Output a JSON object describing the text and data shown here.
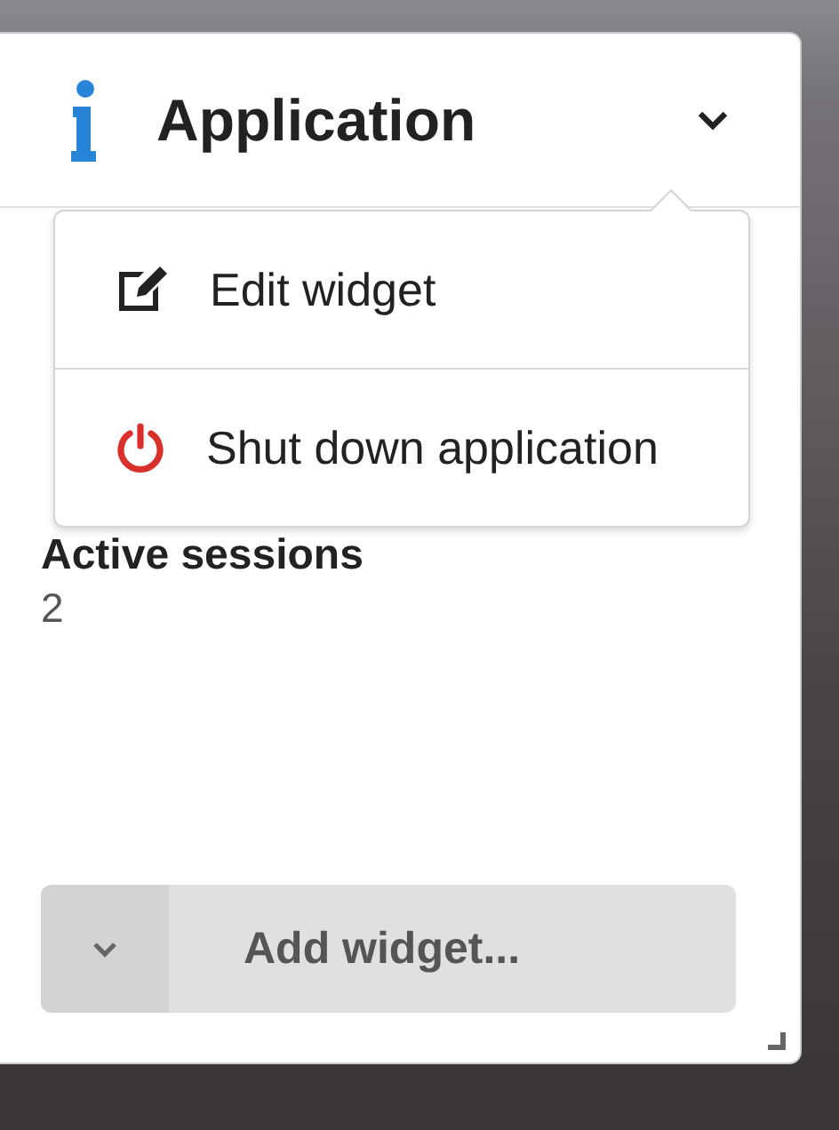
{
  "widget": {
    "title": "Application",
    "fields": [
      {
        "label": "Active sessions",
        "value": "2"
      }
    ],
    "menu": {
      "open": true,
      "items": [
        {
          "kind": "edit",
          "label": "Edit widget"
        },
        {
          "kind": "power",
          "label": "Shut down application"
        }
      ]
    },
    "add_button": {
      "label": "Add widget..."
    }
  }
}
